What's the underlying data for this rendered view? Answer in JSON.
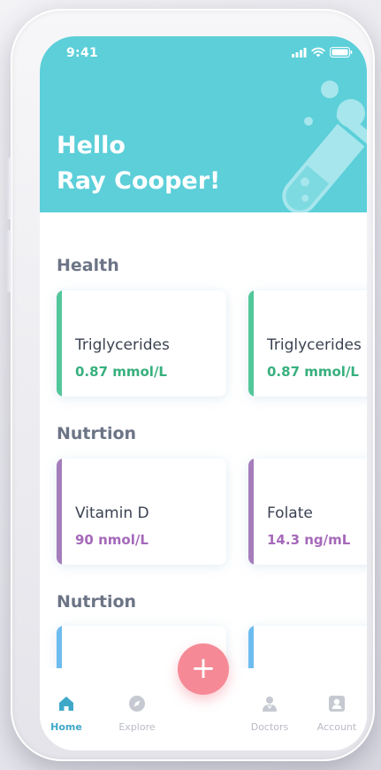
{
  "status": {
    "time": "9:41"
  },
  "header": {
    "greeting_line1": "Hello",
    "greeting_line2": "Ray Cooper!",
    "accent": "#5ccfd9"
  },
  "sections": [
    {
      "title": "Health",
      "color": "#52c79a",
      "cards": [
        {
          "name": "Triglycerides",
          "value": "0.87 mmol/L"
        },
        {
          "name": "Triglycerides",
          "value": "0.87 mmol/L"
        }
      ]
    },
    {
      "title": "Nutrtion",
      "color": "#a57dbb",
      "cards": [
        {
          "name": "Vitamin D",
          "value": "90 nmol/L"
        },
        {
          "name": "Folate",
          "value": "14.3 ng/mL"
        }
      ]
    },
    {
      "title": "Nutrtion",
      "color": "#6dbcf0",
      "cards": [
        {
          "name": "",
          "value": ""
        },
        {
          "name": "",
          "value": ""
        }
      ]
    }
  ],
  "fab": {
    "label": "+",
    "color": "#f58a96"
  },
  "tabs": [
    {
      "label": "Home",
      "icon": "home-icon",
      "active": true
    },
    {
      "label": "Explore",
      "icon": "compass-icon",
      "active": false
    },
    {
      "label": "Doctors",
      "icon": "doctor-icon",
      "active": false
    },
    {
      "label": "Account",
      "icon": "account-icon",
      "active": false
    }
  ]
}
